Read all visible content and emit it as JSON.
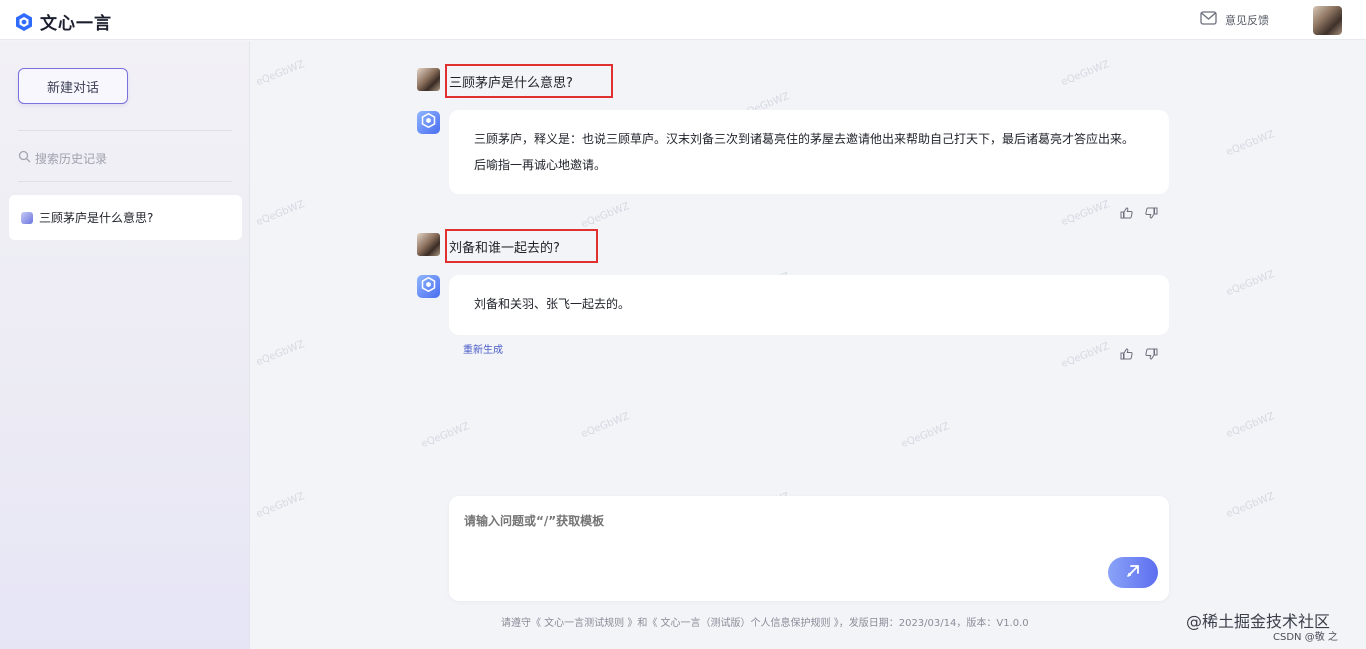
{
  "app": {
    "title": "文心一言",
    "feedback_label": "意见反馈",
    "accent_color": "#5d6ef0"
  },
  "sidebar": {
    "new_chat_label": "新建对话",
    "search_placeholder": "搜索历史记录",
    "history": [
      {
        "title": "三顾茅庐是什么意思?"
      }
    ]
  },
  "conversation": [
    {
      "question": "三顾茅庐是什么意思?",
      "answer": "三顾茅庐，释义是：也说三顾草庐。汉末刘备三次到诸葛亮住的茅屋去邀请他出来帮助自己打天下，最后诸葛亮才答应出来。后喻指一再诚心地邀请。"
    },
    {
      "question": "刘备和谁一起去的?",
      "answer": "刘备和关羽、张飞一起去的。",
      "regenerate_label": "重新生成"
    }
  ],
  "composer": {
    "placeholder": "请输入问题或“/”获取模板"
  },
  "footer": {
    "text": "请遵守《 文心一言测试规则 》和《 文心一言（测试版）个人信息保护规则 》，发版日期：2023/03/14，版本：V1.0.0"
  },
  "watermark": {
    "text": "eQeGbWZ",
    "site": "@稀土掘金技术社区",
    "csdn": "CSDN @敬 之"
  },
  "icons": [
    "logo-icon",
    "mail-icon",
    "search-icon",
    "thumb-up-icon",
    "thumb-down-icon",
    "send-icon",
    "bot-icon"
  ]
}
